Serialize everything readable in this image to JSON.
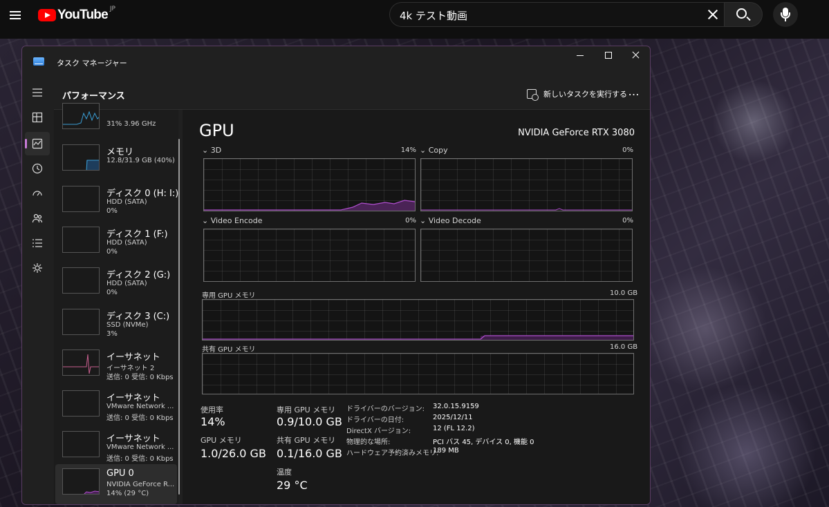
{
  "youtube": {
    "logo_text": "YouTube",
    "region": "JP",
    "search_value": "4k テスト動画"
  },
  "window": {
    "title": "タスク マネージャー"
  },
  "header": {
    "title": "パフォーマンス",
    "run_new_task": "新しいタスクを実行する",
    "more": "…"
  },
  "nav": [
    {
      "icon": "hamburger-menu-icon"
    },
    {
      "icon": "processes-icon"
    },
    {
      "icon": "performance-icon",
      "active": true
    },
    {
      "icon": "app-history-icon"
    },
    {
      "icon": "startup-apps-icon"
    },
    {
      "icon": "users-icon"
    },
    {
      "icon": "details-icon"
    },
    {
      "icon": "services-icon"
    }
  ],
  "resources": [
    {
      "name": "",
      "sub1": "31%  3.96 GHz",
      "sub2": ""
    },
    {
      "name": "メモリ",
      "sub1": "12.8/31.9 GB (40%)",
      "sub2": ""
    },
    {
      "name": "ディスク 0 (H: I:)",
      "sub1": "HDD (SATA)",
      "sub2": "0%"
    },
    {
      "name": "ディスク 1 (F:)",
      "sub1": "HDD (SATA)",
      "sub2": "0%"
    },
    {
      "name": "ディスク 2 (G:)",
      "sub1": "HDD (SATA)",
      "sub2": "0%"
    },
    {
      "name": "ディスク 3 (C:)",
      "sub1": "SSD (NVMe)",
      "sub2": "3%"
    },
    {
      "name": "イーサネット",
      "sub1": "イーサネット 2",
      "sub2": "送信: 0 受信: 0 Kbps"
    },
    {
      "name": "イーサネット",
      "sub1": "VMware Network ...",
      "sub2": "送信: 0 受信: 0 Kbps"
    },
    {
      "name": "イーサネット",
      "sub1": "VMware Network ...",
      "sub2": "送信: 0 受信: 0 Kbps"
    },
    {
      "name": "GPU 0",
      "sub1": "NVIDIA GeForce R...",
      "sub2": "14%  (29 °C)"
    }
  ],
  "gpu": {
    "title": "GPU",
    "model": "NVIDIA GeForce RTX 3080",
    "engines": [
      {
        "label": "3D",
        "percent": "14%"
      },
      {
        "label": "Copy",
        "percent": "0%"
      },
      {
        "label": "Video Encode",
        "percent": "0%"
      },
      {
        "label": "Video Decode",
        "percent": "0%"
      }
    ],
    "dedicated_label": "専用 GPU メモリ",
    "dedicated_max": "10.0 GB",
    "shared_label": "共有 GPU メモリ",
    "shared_max": "16.0 GB",
    "stats": {
      "usage_label": "使用率",
      "usage_value": "14%",
      "gpu_mem_label": "GPU メモリ",
      "gpu_mem_value": "1.0/26.0 GB",
      "dedicated_label": "専用 GPU メモリ",
      "dedicated_value": "0.9/10.0 GB",
      "shared_label": "共有 GPU メモリ",
      "shared_value": "0.1/16.0 GB",
      "temp_label": "温度",
      "temp_value": "29 °C"
    },
    "info": [
      {
        "label": "ドライバーのバージョン:",
        "value": "32.0.15.9159"
      },
      {
        "label": "ドライバーの日付:",
        "value": "2025/12/11"
      },
      {
        "label": "DirectX バージョン:",
        "value": "12 (FL 12.2)"
      },
      {
        "label": "物理的な場所:",
        "value": "PCI バス 45, デバイス 0, 機能 0"
      },
      {
        "label": "ハードウェア予約済みメモリ:",
        "value": "189 MB"
      }
    ]
  },
  "colors": {
    "accent": "#c97bd9",
    "gpu_line": "#b14fd0",
    "gpu_fill": "#4a2356",
    "cpu_line": "#3a9fd6",
    "eth_line": "#c85f8f"
  }
}
